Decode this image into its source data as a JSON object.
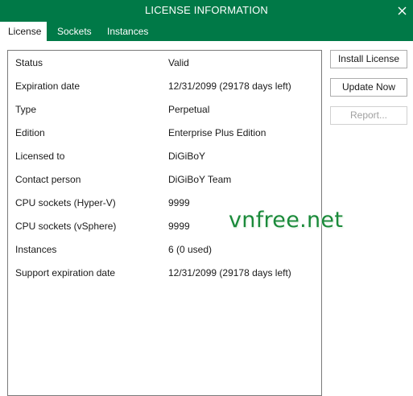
{
  "window": {
    "title": "LICENSE INFORMATION",
    "close_icon": "close-icon",
    "accent_color": "#007947"
  },
  "tabs": [
    {
      "label": "License",
      "active": true
    },
    {
      "label": "Sockets",
      "active": false
    },
    {
      "label": "Instances",
      "active": false
    }
  ],
  "license": {
    "rows": [
      {
        "label": "Status",
        "value": "Valid"
      },
      {
        "label": "Expiration date",
        "value": "12/31/2099 (29178 days left)"
      },
      {
        "label": "Type",
        "value": "Perpetual"
      },
      {
        "label": "Edition",
        "value": "Enterprise Plus Edition"
      },
      {
        "label": "Licensed to",
        "value": "DiGiBoY"
      },
      {
        "label": "Contact person",
        "value": "DiGiBoY Team"
      },
      {
        "label": "CPU sockets (Hyper-V)",
        "value": "9999"
      },
      {
        "label": "CPU sockets (vSphere)",
        "value": "9999"
      },
      {
        "label": "Instances",
        "value": "6 (0 used)"
      },
      {
        "label": "Support expiration date",
        "value": "12/31/2099 (29178 days left)"
      }
    ]
  },
  "actions": {
    "install_label": "Install License",
    "update_label": "Update Now",
    "report_label": "Report...",
    "report_enabled": false
  },
  "watermark": {
    "text": "vnfree.net"
  }
}
